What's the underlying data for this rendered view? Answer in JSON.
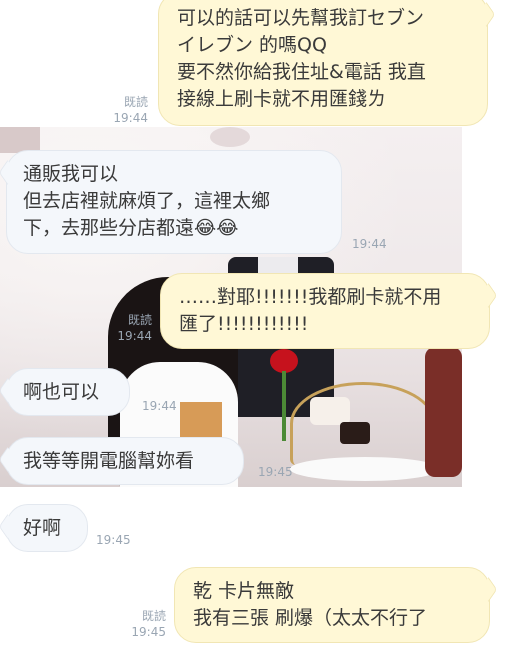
{
  "messages": [
    {
      "side": "out",
      "text": "可以的話可以先幫我訂セブン\nイレブン 的嗎QQ\n要不然你給我住址&電話 我直\n接線上刷卡就不用匯錢ㄌ",
      "read": "既読",
      "time": "19:44"
    },
    {
      "side": "in",
      "text": "通販我可以\n但去店裡就麻煩了，這裡太鄉\n下，去那些分店都遠😂😂",
      "time": "19:44"
    },
    {
      "side": "out",
      "text": "……對耶!!!!!!!我都刷卡就不用\n匯了!!!!!!!!!!!!",
      "read": "既読",
      "time": "19:44"
    },
    {
      "side": "in",
      "text": "啊也可以",
      "time": "19:44"
    },
    {
      "side": "in",
      "text": "我等等開電腦幫妳看",
      "time": "19:45"
    },
    {
      "side": "in",
      "text": "好啊",
      "time": "19:45"
    },
    {
      "side": "out",
      "text": "乾 卡片無敵\n我有三張 刷爆（太太不行了",
      "read": "既読",
      "time": "19:45"
    }
  ]
}
